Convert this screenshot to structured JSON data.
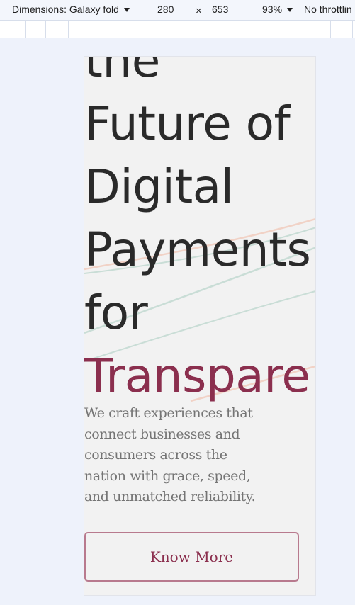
{
  "devtools": {
    "dimensions_label": "Dimensions: Galaxy fold",
    "width": "280",
    "times": "×",
    "height": "653",
    "zoom": "93%",
    "throttling": "No throttlin"
  },
  "hero": {
    "title_lines": [
      "the",
      "Future of",
      "Digital",
      "Payments",
      "for"
    ],
    "title_accent": "Transpare",
    "subtitle": "We craft experiences that connect businesses and consumers across the nation with grace, speed, and unmatched reliability.",
    "cta_label": "Know More"
  },
  "colors": {
    "accent": "#8b2f4e",
    "cta_border": "#b87a8e",
    "title": "#2a2a2a",
    "subtitle": "#747474",
    "background": "#f2f2f2",
    "wave_peach": "#f1d2c6",
    "wave_green": "#c9ddd6"
  }
}
